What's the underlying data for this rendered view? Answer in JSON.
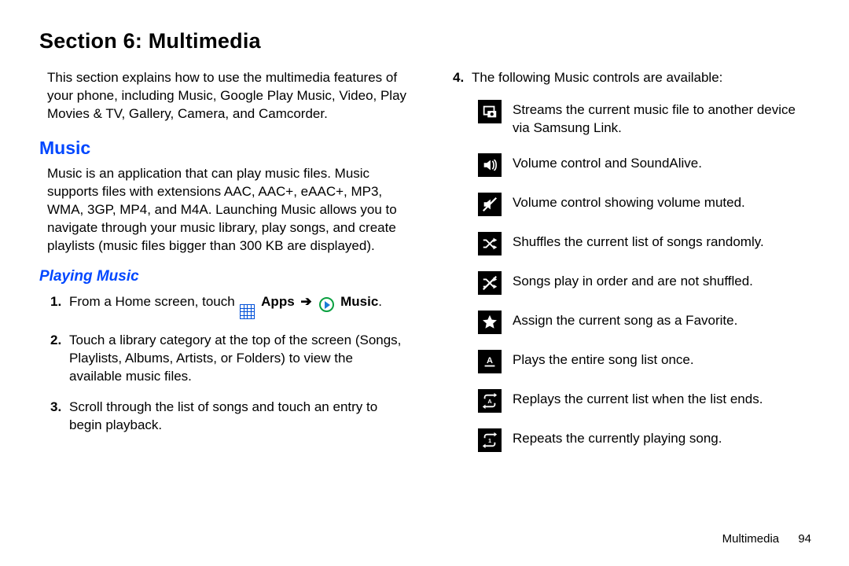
{
  "section_title": "Section 6: Multimedia",
  "left": {
    "intro": "This section explains how to use the multimedia features of your phone, including Music, Google Play Music, Video, Play Movies & TV, Gallery, Camera, and Camcorder.",
    "music_heading": "Music",
    "music_desc": "Music is an application that can play music files. Music supports files with extensions AAC, AAC+, eAAC+, MP3, WMA, 3GP, MP4, and M4A. Launching Music allows you to navigate through your music library, play songs, and create playlists (music files bigger than 300 KB are displayed).",
    "playing_heading": "Playing Music",
    "step1_prefix": "From a Home screen, touch ",
    "step1_apps": "Apps",
    "step1_music": "Music",
    "step2": "Touch a library category at the top of the screen (Songs, Playlists, Albums, Artists, or Folders) to view the available music files.",
    "step3": "Scroll through the list of songs and touch an entry to begin playback."
  },
  "right": {
    "step4": "The following Music controls are available:",
    "controls": [
      "Streams the current music file to another device via Samsung Link.",
      "Volume control and SoundAlive.",
      "Volume control showing volume muted.",
      "Shuffles the current list of songs randomly.",
      "Songs play in order and are not shuffled.",
      "Assign the current song as a Favorite.",
      "Plays the entire song list once.",
      "Replays the current list when the list ends.",
      "Repeats the currently playing song."
    ]
  },
  "footer": {
    "chapter": "Multimedia",
    "page": "94"
  }
}
